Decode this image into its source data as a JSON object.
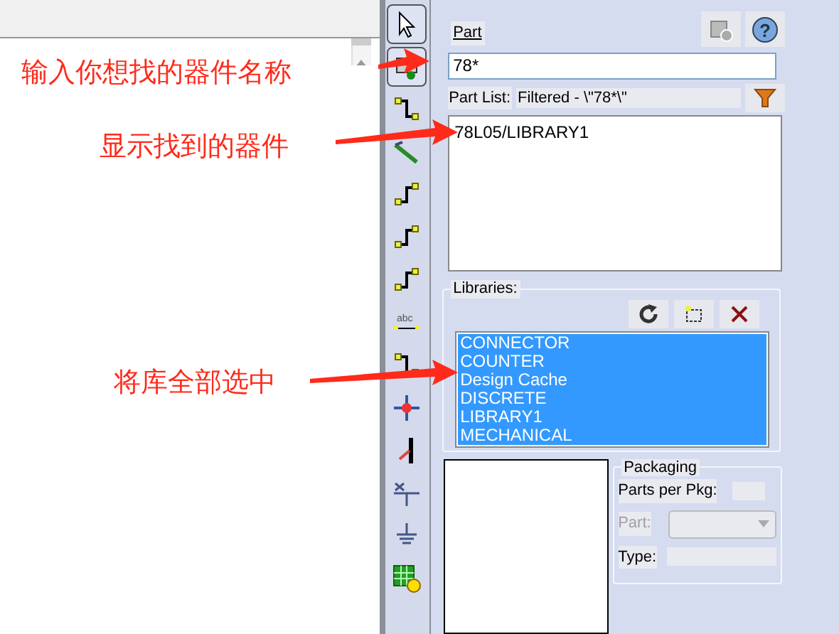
{
  "annotations": [
    {
      "text": "输入你想找的器件名称"
    },
    {
      "text": "显示找到的器件"
    },
    {
      "text": "将库全部选中"
    }
  ],
  "toolbar": [
    {
      "kind": "select",
      "selected": true
    },
    {
      "kind": "part",
      "selected": true
    },
    {
      "kind": "wire",
      "selected": false
    },
    {
      "kind": "bus",
      "selected": false
    },
    {
      "kind": "junction",
      "selected": false
    },
    {
      "kind": "junction",
      "selected": false
    },
    {
      "kind": "junction",
      "selected": false
    },
    {
      "kind": "label",
      "text": "abc",
      "selected": false
    },
    {
      "kind": "wire",
      "selected": false
    },
    {
      "kind": "cross",
      "selected": false
    },
    {
      "kind": "entry",
      "selected": false
    },
    {
      "kind": "noconnect",
      "selected": false
    },
    {
      "kind": "ground",
      "selected": false
    },
    {
      "kind": "grid",
      "selected": false
    }
  ],
  "panel": {
    "part_label": "Part",
    "part_value": "78*",
    "help_mark": "?",
    "part_list_label": "Part List:",
    "part_list_filter": "Filtered - \\\"78*\\\"",
    "parts": [
      {
        "name": "78L05/LIBRARY1"
      }
    ],
    "libraries_label": "Libraries:",
    "libraries": [
      {
        "name": "CONNECTOR",
        "selected": true
      },
      {
        "name": "COUNTER",
        "selected": true
      },
      {
        "name": "Design Cache",
        "selected": true
      },
      {
        "name": "DISCRETE",
        "selected": true
      },
      {
        "name": "LIBRARY1",
        "selected": true
      },
      {
        "name": "MECHANICAL",
        "selected": true
      }
    ],
    "packaging": {
      "title": "Packaging",
      "parts_per_pkg_label": "Parts per Pkg:",
      "part_label": "Part:",
      "part_disabled": true,
      "type_label": "Type:"
    }
  }
}
